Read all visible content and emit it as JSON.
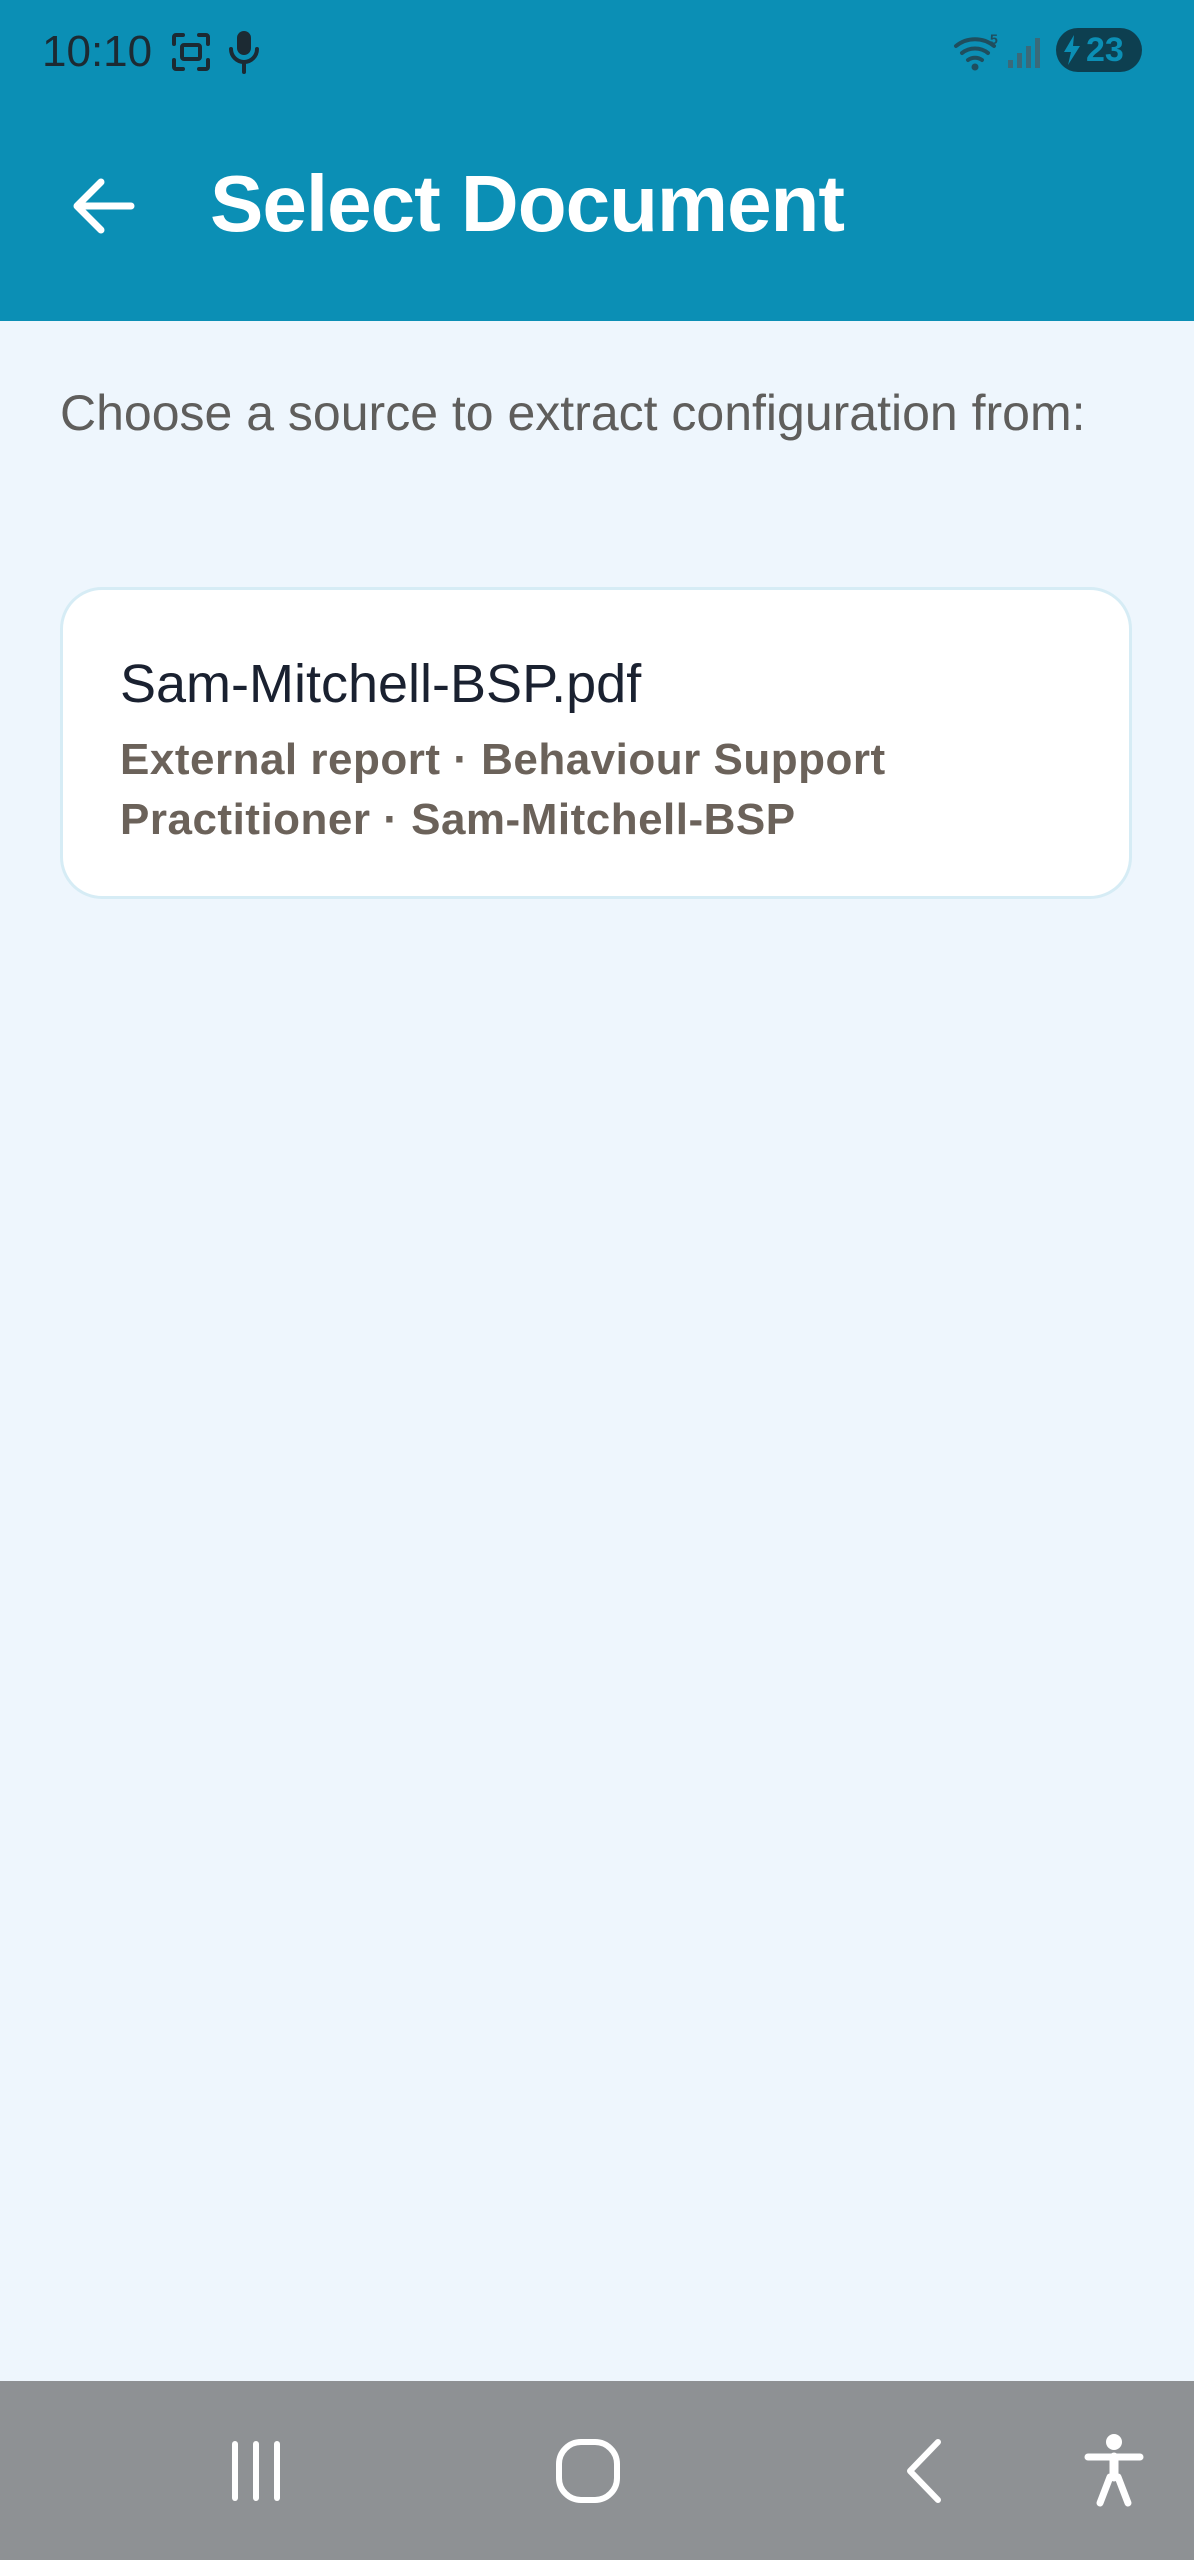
{
  "status_bar": {
    "time": "10:10",
    "battery": "23",
    "icons": [
      "screenshot-icon",
      "microphone-icon",
      "wifi-icon",
      "signal-icon",
      "battery-icon"
    ]
  },
  "toolbar": {
    "title": "Select Document",
    "back_icon": "arrow-left-icon"
  },
  "main": {
    "subtitle": "Choose a source to extract configuration from:",
    "documents": [
      {
        "title": "Sam-Mitchell-BSP.pdf",
        "meta": "External report · Behaviour Support Practitioner · Sam-Mitchell-BSP"
      }
    ]
  },
  "nav_bar": {
    "icons": [
      "recent-apps-icon",
      "home-icon",
      "back-icon",
      "accessibility-icon"
    ]
  },
  "colors": {
    "app_bar": "#0b8fb5",
    "background": "#eef6fd",
    "card": "#ffffff",
    "card_border": "#d6ecf5",
    "title_text": "#1a2130",
    "meta_text": "#6b625a",
    "nav_bar": "#8e9194"
  }
}
